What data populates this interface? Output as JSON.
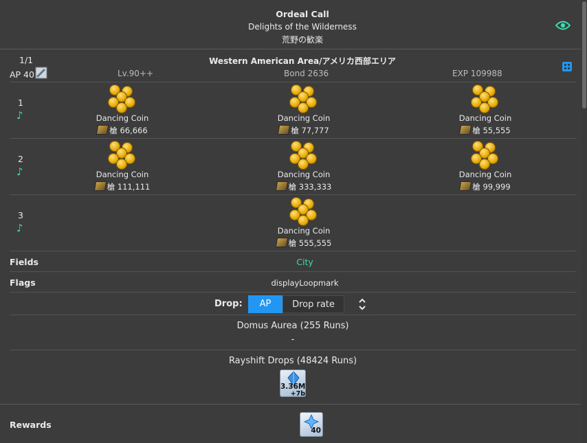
{
  "header": {
    "title": "Ordeal Call",
    "subtitle": "Delights of the Wilderness",
    "subtitle_jp": "荒野の歓楽",
    "eye_icon": "eye-icon"
  },
  "quest": {
    "phase": "1/1",
    "ap": "AP 40",
    "area": "Western American Area/アメリカ西部エリア",
    "level": "Lv.90++",
    "bond": "Bond 2636",
    "exp": "EXP 109988"
  },
  "waves": [
    {
      "num": "1",
      "enemies": [
        {
          "name": "Dancing Coin",
          "class": "槍",
          "hp": "66,666"
        },
        {
          "name": "Dancing Coin",
          "class": "槍",
          "hp": "77,777"
        },
        {
          "name": "Dancing Coin",
          "class": "槍",
          "hp": "55,555"
        }
      ]
    },
    {
      "num": "2",
      "enemies": [
        {
          "name": "Dancing Coin",
          "class": "槍",
          "hp": "111,111"
        },
        {
          "name": "Dancing Coin",
          "class": "槍",
          "hp": "333,333"
        },
        {
          "name": "Dancing Coin",
          "class": "槍",
          "hp": "99,999"
        }
      ]
    },
    {
      "num": "3",
      "enemies": [
        {
          "name": "Dancing Coin",
          "class": "槍",
          "hp": "555,555"
        }
      ]
    }
  ],
  "fields": {
    "label": "Fields",
    "value": "City"
  },
  "flags": {
    "label": "Flags",
    "value": "displayLoopmark"
  },
  "drop": {
    "label": "Drop:",
    "options": [
      "AP",
      "Drop rate"
    ],
    "selected": "AP"
  },
  "domus": {
    "title": "Domus Aurea (255 Runs)",
    "value": "-"
  },
  "rayshift": {
    "title": "Rayshift Drops (48424 Runs)",
    "item_value": "3.36M",
    "item_extra": "+7b"
  },
  "rewards": {
    "label": "Rewards",
    "item_count": "40"
  },
  "colors": {
    "accent": "#2196f3",
    "teal": "#3ddbb0",
    "background": "#3c3c3c"
  }
}
